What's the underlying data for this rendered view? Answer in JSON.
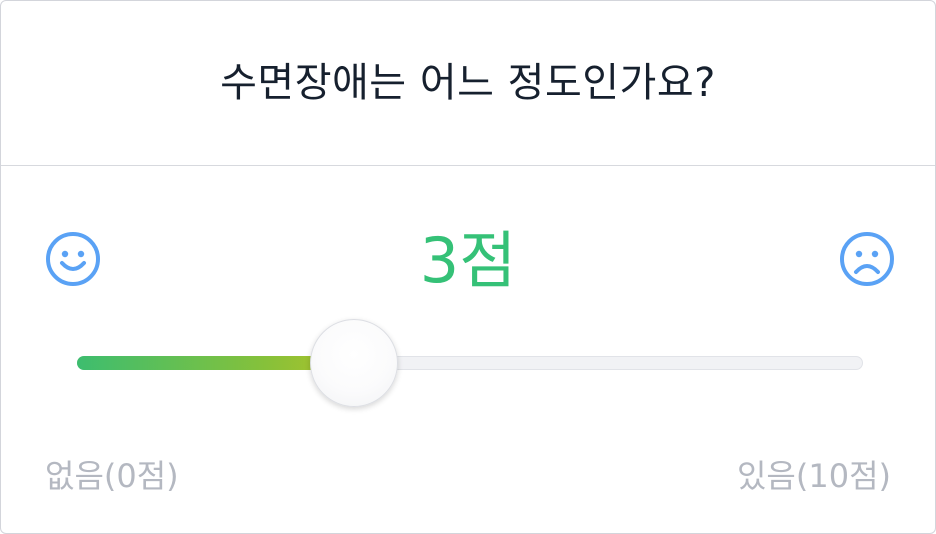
{
  "question": "수면장애는 어느 정도인가요?",
  "score": {
    "value": 3,
    "display": "3점"
  },
  "slider": {
    "min": 0,
    "max": 10,
    "value": 3,
    "min_label": "없음(0점)",
    "max_label": "있음(10점)"
  },
  "icons": {
    "left": "smile-face-icon",
    "right": "sad-face-icon"
  },
  "colors": {
    "icon": "#5aa2f5",
    "score": "#35c177",
    "fill_start": "#3dbd6f",
    "fill_end": "#aec22a",
    "label": "#b4b8c1",
    "question": "#16202e"
  }
}
